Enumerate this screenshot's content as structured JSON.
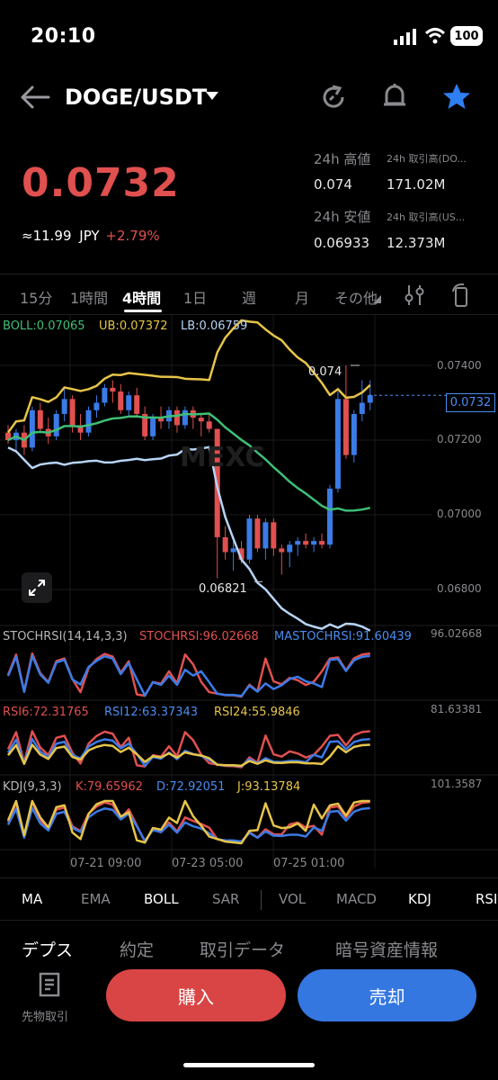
{
  "status_bar": {
    "time": "20:10",
    "battery": "100"
  },
  "header": {
    "pair": "DOGE/USDT"
  },
  "ticker": {
    "last_price": "0.0732",
    "approx_jpy": "≈11.99",
    "jpy_unit": "JPY",
    "change_pct": "+2.79%",
    "high_label": "24h 高値",
    "high_value": "0.074",
    "low_label": "24h 安値",
    "low_value": "0.06933",
    "vol_base_label": "24h 取引高(DO...",
    "vol_base_value": "171.02M",
    "vol_quote_label": "24h 取引高(US...",
    "vol_quote_value": "12.373M"
  },
  "timeframes": {
    "items": [
      "15分",
      "1時間",
      "4時間",
      "1日",
      "週",
      "月",
      "その他"
    ],
    "active": "4時間"
  },
  "chart_data": {
    "type": "candlestick",
    "boll": {
      "label": "BOLL:0.07065",
      "ub": "UB:0.07372",
      "lb": "LB:0.06759"
    },
    "y_ticks": [
      "0.07400",
      "0.07200",
      "0.07000",
      "0.06800"
    ],
    "current_price_tag": "0.0732",
    "high_marker": "0.074",
    "low_marker": "0.06821",
    "x_ticks": [
      "07-21 09:00",
      "07-23 05:00",
      "07-25 01:00"
    ],
    "stochrsi": {
      "params": "STOCHRSI(14,14,3,3)",
      "main": "STOCHRSI:96.02668",
      "ma": "MASTOCHRSI:91.60439",
      "max": "96.02668"
    },
    "rsi": {
      "rsi6": "RSI6:72.31765",
      "rsi12": "RSI12:63.37343",
      "rsi24": "RSI24:55.9846",
      "max": "81.63381"
    },
    "kdj": {
      "params": "KDJ(9,3,3)",
      "k": "K:79.65962",
      "d": "D:72.92051",
      "j": "J:93.13784",
      "max": "101.3587"
    },
    "candles": [
      [
        0.0722,
        0.0724,
        0.0719,
        0.072
      ],
      [
        0.072,
        0.0723,
        0.0717,
        0.0722
      ],
      [
        0.0722,
        0.0724,
        0.0716,
        0.0718
      ],
      [
        0.0718,
        0.0729,
        0.0717,
        0.0728
      ],
      [
        0.0728,
        0.073,
        0.0722,
        0.0723
      ],
      [
        0.0723,
        0.0726,
        0.0719,
        0.0721
      ],
      [
        0.0721,
        0.0728,
        0.072,
        0.0727
      ],
      [
        0.0727,
        0.0734,
        0.0725,
        0.0731
      ],
      [
        0.0731,
        0.0732,
        0.0722,
        0.0724
      ],
      [
        0.0724,
        0.0727,
        0.072,
        0.0722
      ],
      [
        0.0722,
        0.0729,
        0.0721,
        0.0728
      ],
      [
        0.0728,
        0.0732,
        0.0726,
        0.073
      ],
      [
        0.073,
        0.0735,
        0.0729,
        0.0734
      ],
      [
        0.0734,
        0.0736,
        0.073,
        0.0733
      ],
      [
        0.0733,
        0.0735,
        0.0727,
        0.0728
      ],
      [
        0.0728,
        0.0733,
        0.0726,
        0.0732
      ],
      [
        0.0732,
        0.0734,
        0.0726,
        0.0727
      ],
      [
        0.0727,
        0.0729,
        0.072,
        0.0721
      ],
      [
        0.0721,
        0.0727,
        0.072,
        0.0726
      ],
      [
        0.0726,
        0.0729,
        0.0723,
        0.0725
      ],
      [
        0.0725,
        0.0729,
        0.0723,
        0.0728
      ],
      [
        0.0728,
        0.0729,
        0.0722,
        0.0724
      ],
      [
        0.0724,
        0.0729,
        0.0723,
        0.0728
      ],
      [
        0.0728,
        0.0729,
        0.0723,
        0.0726
      ],
      [
        0.0726,
        0.0727,
        0.0721,
        0.0725
      ],
      [
        0.0725,
        0.0727,
        0.0722,
        0.0723
      ],
      [
        0.0723,
        0.0723,
        0.0683,
        0.0694
      ],
      [
        0.0694,
        0.0697,
        0.0688,
        0.069
      ],
      [
        0.069,
        0.0693,
        0.0685,
        0.0691
      ],
      [
        0.0691,
        0.0693,
        0.0687,
        0.0688
      ],
      [
        0.0688,
        0.07,
        0.0687,
        0.0699
      ],
      [
        0.0699,
        0.07,
        0.069,
        0.0691
      ],
      [
        0.0691,
        0.0699,
        0.0688,
        0.0698
      ],
      [
        0.0698,
        0.0699,
        0.0689,
        0.0691
      ],
      [
        0.0691,
        0.0692,
        0.0684,
        0.069
      ],
      [
        0.069,
        0.0693,
        0.0686,
        0.0692
      ],
      [
        0.0692,
        0.0694,
        0.0689,
        0.0693
      ],
      [
        0.0693,
        0.0695,
        0.0691,
        0.0692
      ],
      [
        0.0692,
        0.0694,
        0.069,
        0.0693
      ],
      [
        0.0693,
        0.0695,
        0.0691,
        0.0692
      ],
      [
        0.0692,
        0.0708,
        0.0691,
        0.0707
      ],
      [
        0.0707,
        0.0733,
        0.0706,
        0.0731
      ],
      [
        0.0731,
        0.074,
        0.0715,
        0.0716
      ],
      [
        0.0716,
        0.0728,
        0.0714,
        0.0727
      ],
      [
        0.0727,
        0.0736,
        0.0725,
        0.073
      ],
      [
        0.073,
        0.0736,
        0.0728,
        0.0732
      ]
    ]
  },
  "indicator_tabs": {
    "items": [
      "MA",
      "EMA",
      "BOLL",
      "SAR",
      "VOL",
      "MACD",
      "KDJ",
      "RSI"
    ],
    "on": [
      "BOLL",
      "KDJ",
      "RSI"
    ]
  },
  "bottom_tabs": {
    "items": [
      "デプス",
      "約定",
      "取引データ",
      "暗号資産情報"
    ],
    "active": "デプス"
  },
  "actions": {
    "futures": "先物取引",
    "buy": "購入",
    "sell": "売却"
  },
  "colors": {
    "up": "#e0504f",
    "down": "#3b7be6",
    "boll_mid": "#3fbf76",
    "boll_ub": "#e6c449",
    "boll_lb": "#b7d4f5",
    "stoch_main": "#e0504f",
    "stoch_ma": "#3b7be6"
  }
}
